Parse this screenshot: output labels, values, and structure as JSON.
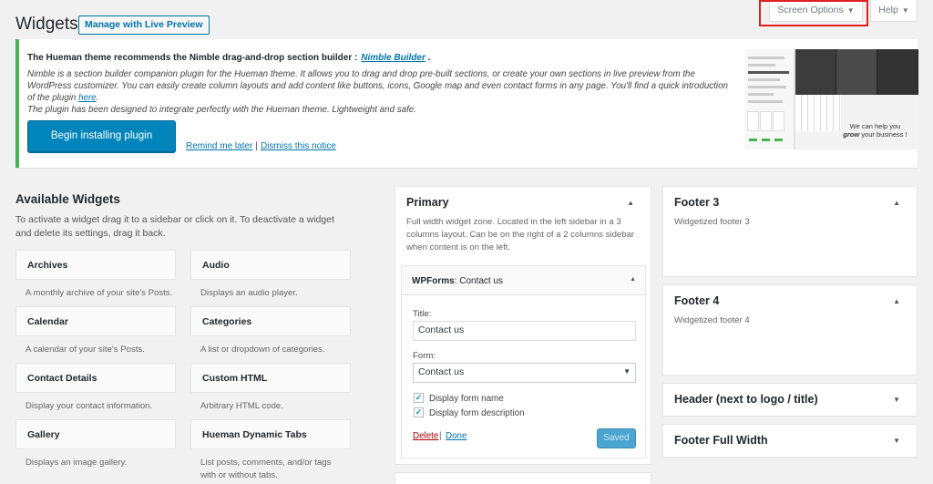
{
  "header": {
    "title": "Widgets",
    "live_preview": "Manage with Live Preview",
    "screen_options": "Screen Options",
    "help": "Help"
  },
  "notice": {
    "headline": "The Hueman theme recommends the Nimble drag-and-drop section builder :",
    "plugin_link": "Nimble Builder",
    "headline_end": ".",
    "line1": "Nimble is a section builder companion plugin for the Hueman theme. It allows you to drag and drop pre-built sections, or create your own sections in live preview from the WordPress customizer. You can easily create column layouts and add content like buttons, icons, Google map and even contact forms in any page. You'll find a quick introduction of the plugin",
    "here": "here",
    "line1_end": ".",
    "line2": "The plugin has been designed to integrate perfectly with the Hueman theme. Lightweight and safe.",
    "install_button": "Begin installing plugin",
    "remind": "Remind me later",
    "separator": "|",
    "dismiss": "Dismiss this notice",
    "promo": {
      "hero_line1": "We can help you",
      "hero_bold": "grow",
      "hero_line2": "your business !"
    }
  },
  "available": {
    "title": "Available Widgets",
    "description": "To activate a widget drag it to a sidebar or click on it. To deactivate a widget and delete its settings, drag it back.",
    "widgets": [
      {
        "name": "Archives",
        "desc": "A monthly archive of your site's Posts."
      },
      {
        "name": "Audio",
        "desc": "Displays an audio player."
      },
      {
        "name": "Calendar",
        "desc": "A calendar of your site's Posts."
      },
      {
        "name": "Categories",
        "desc": "A list or dropdown of categories."
      },
      {
        "name": "Contact Details",
        "desc": "Display your contact information."
      },
      {
        "name": "Custom HTML",
        "desc": "Arbitrary HTML code."
      },
      {
        "name": "Gallery",
        "desc": "Displays an image gallery."
      },
      {
        "name": "Hueman Dynamic Tabs",
        "desc": "List posts, comments, and/or tags with or without tabs."
      }
    ]
  },
  "primary": {
    "title": "Primary",
    "description": "Full width widget zone. Located in the left sidebar in a 3 columns layout. Can be on the right of a 2 columns sidebar when content is on the left.",
    "widget": {
      "name": "WPForms",
      "name_suffix": ": Contact us",
      "title_label": "Title:",
      "title_value": "Contact us",
      "form_label": "Form:",
      "form_value": "Contact us",
      "check1": "Display form name",
      "check2": "Display form description",
      "delete": "Delete",
      "sep": "|",
      "done": "Done",
      "saved": "Saved"
    }
  },
  "right_sidebars": [
    {
      "title": "Footer 3",
      "desc": "Widgetized footer 3"
    },
    {
      "title": "Footer 4",
      "desc": "Widgetized footer 4"
    },
    {
      "title": "Header (next to logo / title)"
    },
    {
      "title": "Footer Full Width"
    }
  ]
}
